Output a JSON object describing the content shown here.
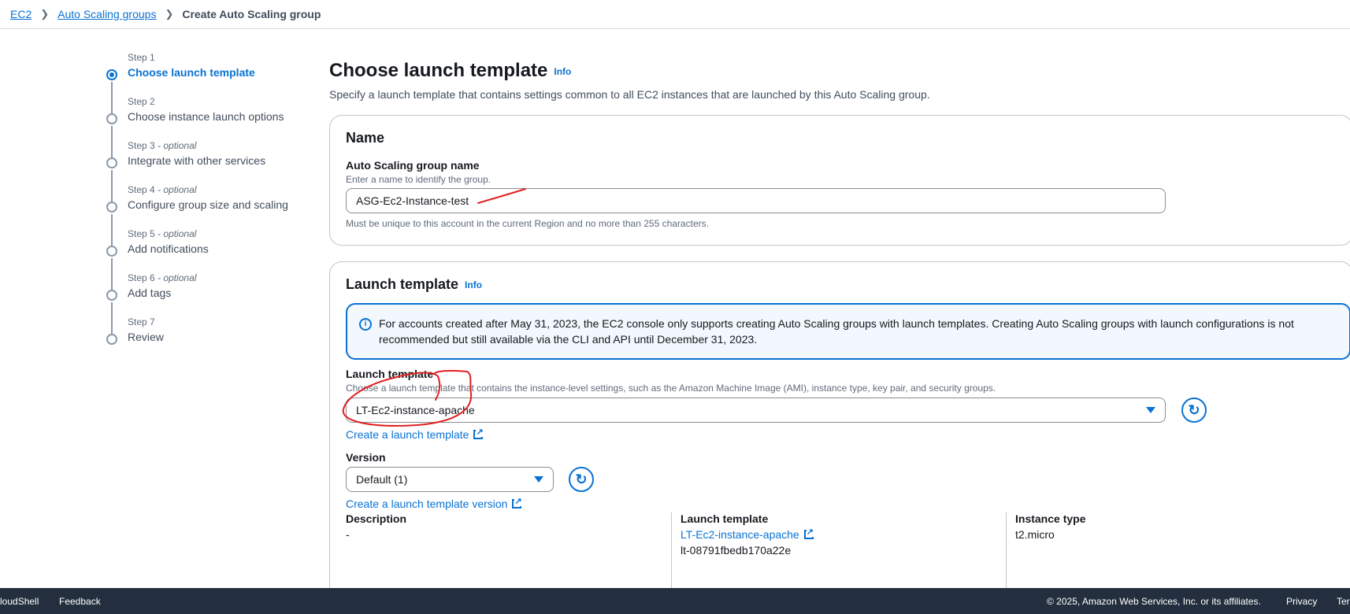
{
  "breadcrumb": {
    "ec2": "EC2",
    "asg": "Auto Scaling groups",
    "current": "Create Auto Scaling group"
  },
  "steps": [
    {
      "label": "Step 1",
      "optional": "",
      "title": "Choose launch template"
    },
    {
      "label": "Step 2",
      "optional": "",
      "title": "Choose instance launch options"
    },
    {
      "label": "Step 3",
      "optional": " - optional",
      "title": "Integrate with other services"
    },
    {
      "label": "Step 4",
      "optional": " - optional",
      "title": "Configure group size and scaling"
    },
    {
      "label": "Step 5",
      "optional": " - optional",
      "title": "Add notifications"
    },
    {
      "label": "Step 6",
      "optional": " - optional",
      "title": "Add tags"
    },
    {
      "label": "Step 7",
      "optional": "",
      "title": "Review"
    }
  ],
  "page": {
    "title": "Choose launch template",
    "info": "Info",
    "description": "Specify a launch template that contains settings common to all EC2 instances that are launched by this Auto Scaling group."
  },
  "name_card": {
    "heading": "Name",
    "field_label": "Auto Scaling group name",
    "field_desc": "Enter a name to identify the group.",
    "value": "ASG-Ec2-Instance-test",
    "constraint": "Must be unique to this account in the current Region and no more than 255 characters."
  },
  "lt_card": {
    "heading": "Launch template",
    "info": "Info",
    "alert": "For accounts created after May 31, 2023, the EC2 console only supports creating Auto Scaling groups with launch templates. Creating Auto Scaling groups with launch configurations is not recommended but still available via the CLI and API until December 31, 2023.",
    "field_label": "Launch template",
    "field_desc": "Choose a launch template that contains the instance-level settings, such as the Amazon Machine Image (AMI), instance type, key pair, and security groups.",
    "selected": "LT-Ec2-instance-apache",
    "create_link": "Create a launch template",
    "version_label": "Version",
    "version_selected": "Default (1)",
    "create_version_link": "Create a launch template version",
    "details": {
      "description_head": "Description",
      "description_val": "-",
      "lt_head": "Launch template",
      "lt_link": "LT-Ec2-instance-apache",
      "lt_id": "lt-08791fbedb170a22e",
      "type_head": "Instance type",
      "type_val": "t2.micro"
    }
  },
  "footer": {
    "cloudshell": "loudShell",
    "feedback": "Feedback",
    "copyright": "© 2025, Amazon Web Services, Inc. or its affiliates.",
    "privacy": "Privacy",
    "terms": "Ter"
  },
  "colors": {
    "link": "#0972d3",
    "footer_bg": "#232f3e",
    "annotation": "#e02020"
  }
}
